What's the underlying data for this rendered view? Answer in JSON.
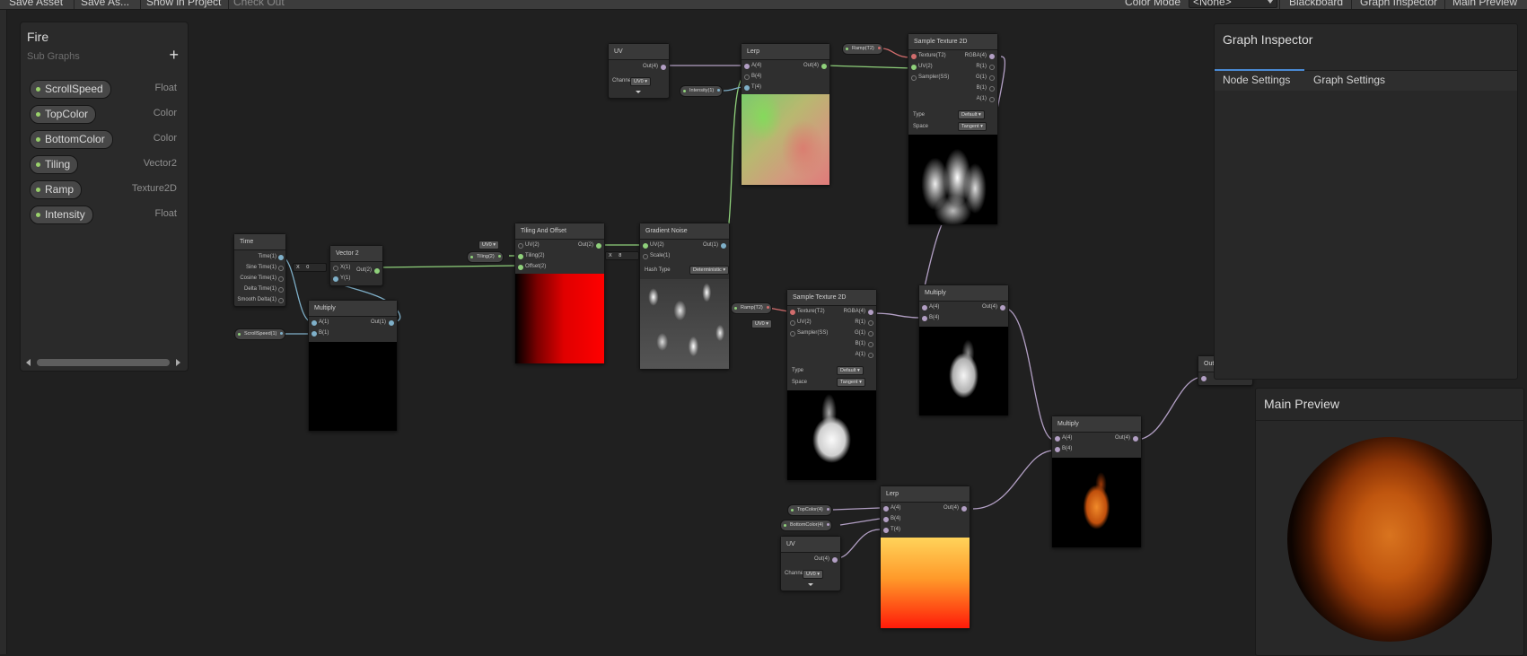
{
  "toolbar": {
    "save_asset": "Save Asset",
    "save_as": "Save As...",
    "show_in_project": "Show in Project",
    "check_out": "Check Out",
    "color_mode_label": "Color Mode",
    "color_mode_value": "<None>",
    "blackboard": "Blackboard",
    "graph_inspector": "Graph Inspector",
    "main_preview": "Main Preview"
  },
  "blackboard": {
    "title": "Fire",
    "subtitle": "Sub Graphs",
    "add": "+",
    "properties": [
      {
        "name": "ScrollSpeed",
        "type": "Float"
      },
      {
        "name": "TopColor",
        "type": "Color"
      },
      {
        "name": "BottomColor",
        "type": "Color"
      },
      {
        "name": "Tiling",
        "type": "Vector2"
      },
      {
        "name": "Ramp",
        "type": "Texture2D"
      },
      {
        "name": "Intensity",
        "type": "Float"
      }
    ]
  },
  "nodes": {
    "time": {
      "title": "Time",
      "ports": [
        "Time(1)",
        "Sine Time(1)",
        "Cosine Time(1)",
        "Delta Time(1)",
        "Smooth Delta(1)"
      ]
    },
    "vector2": {
      "title": "Vector 2",
      "in_x": "X(1)",
      "in_y": "Y(1)",
      "out": "Out(2)",
      "x_label": "X",
      "x_value": "0"
    },
    "multiply1": {
      "title": "Multiply",
      "in_a": "A(1)",
      "in_b": "B(1)",
      "out": "Out(1)"
    },
    "tiling": {
      "title": "Tiling And Offset",
      "in_uv": "UV(2)",
      "in_tiling": "Tiling(2)",
      "in_offset": "Offset(2)",
      "out": "Out(2)",
      "uv_value": "UV0"
    },
    "noise": {
      "title": "Gradient Noise",
      "in_uv": "UV(2)",
      "in_scale": "Scale(1)",
      "out": "Out(1)",
      "hash_label": "Hash Type",
      "hash_value": "Deterministic",
      "scale_label": "X",
      "scale_value": "8"
    },
    "uv1": {
      "title": "UV",
      "out": "Out(4)",
      "channel_label": "Channel",
      "channel_value": "UV0"
    },
    "lerp1": {
      "title": "Lerp",
      "in_a": "A(4)",
      "in_b": "B(4)",
      "in_t": "T(4)",
      "out": "Out(4)"
    },
    "sample1": {
      "title": "Sample Texture 2D",
      "in_tex": "Texture(T2)",
      "in_uv": "UV(2)",
      "in_sampler": "Sampler(SS)",
      "out_rgba": "RGBA(4)",
      "out_r": "R(1)",
      "out_g": "G(1)",
      "out_b": "B(1)",
      "out_a": "A(1)",
      "type_label": "Type",
      "type_value": "Default",
      "space_label": "Space",
      "space_value": "Tangent"
    },
    "sample2": {
      "title": "Sample Texture 2D",
      "in_tex": "Texture(T2)",
      "in_uv": "UV(2)",
      "in_sampler": "Sampler(SS)",
      "out_rgba": "RGBA(4)",
      "out_r": "R(1)",
      "out_g": "G(1)",
      "out_b": "B(1)",
      "out_a": "A(1)",
      "type_label": "Type",
      "type_value": "Default",
      "space_label": "Space",
      "space_value": "Tangent",
      "uv_value": "UV0"
    },
    "multiply2": {
      "title": "Multiply",
      "in_a": "A(4)",
      "in_b": "B(4)",
      "out": "Out(4)"
    },
    "multiply3": {
      "title": "Multiply",
      "in_a": "A(4)",
      "in_b": "B(4)",
      "out": "Out(4)"
    },
    "lerp2": {
      "title": "Lerp",
      "in_a": "A(4)",
      "in_b": "B(4)",
      "in_t": "T(4)",
      "out": "Out(4)"
    },
    "uv2": {
      "title": "UV",
      "out": "Out(4)",
      "channel_label": "Channel",
      "channel_value": "UV0"
    },
    "output": {
      "title": "Outp"
    }
  },
  "property_nodes": {
    "scrollspeed": "ScrollSpeed(1)",
    "tiling": "Tiling(2)",
    "intensity": "Intensity(1)",
    "ramp_top": "Ramp(T2)",
    "ramp_mid": "Ramp(T2)",
    "topcolor": "TopColor(4)",
    "bottomcolor": "BottomColor(4)"
  },
  "inspector": {
    "title": "Graph Inspector",
    "tabs": [
      "Node Settings",
      "Graph Settings"
    ]
  },
  "main_preview": {
    "title": "Main Preview"
  },
  "colors": {
    "accent": "#4a8ad4",
    "float": "#7fb0c9",
    "vector": "#b29fc4",
    "vector2": "#8fd17b",
    "texture": "#d16d6d"
  }
}
